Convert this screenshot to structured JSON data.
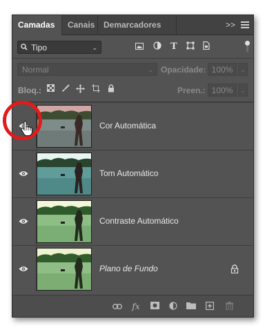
{
  "tabs": [
    {
      "label": "Camadas",
      "active": true
    },
    {
      "label": "Canais",
      "active": false
    },
    {
      "label": "Demarcadores",
      "active": false
    }
  ],
  "collapse_label": ">>",
  "filter": {
    "selected": "Tipo",
    "icons": [
      "image-filter-icon",
      "adjustment-filter-icon",
      "type-filter-icon",
      "shape-filter-icon",
      "smart-object-filter-icon"
    ]
  },
  "blend": {
    "mode": "Normal",
    "opacity_label": "Opacidade:",
    "opacity_value": "100%"
  },
  "lock": {
    "label": "Bloq.:",
    "fill_label": "Preen.:",
    "fill_value": "100%"
  },
  "type_icon_glyph": "T",
  "footer_icons": [
    "link-icon",
    "fx-icon",
    "mask-icon",
    "adjustment-layer-icon",
    "folder-icon",
    "new-layer-icon",
    "trash-icon"
  ],
  "fx_glyph": "fx",
  "layers": [
    {
      "name": "Cor Automática",
      "visible": true,
      "italic": false,
      "locked": false,
      "tone": "original"
    },
    {
      "name": "Tom Automático",
      "visible": true,
      "italic": false,
      "locked": false,
      "tone": "teal"
    },
    {
      "name": "Contraste Automático",
      "visible": true,
      "italic": false,
      "locked": false,
      "tone": "green"
    },
    {
      "name": "Plano de Fundo",
      "visible": true,
      "italic": true,
      "locked": true,
      "tone": "green"
    }
  ],
  "colors": {
    "annotation": "#e21a1a",
    "panel": "#535353"
  }
}
